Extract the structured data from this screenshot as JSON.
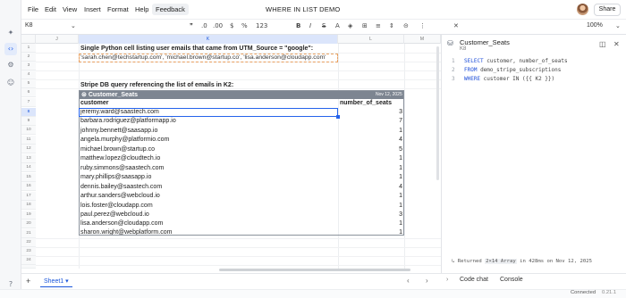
{
  "app": {
    "title": "WHERE IN LIST DEMO",
    "share_label": "Share"
  },
  "menu": [
    "File",
    "Edit",
    "View",
    "Insert",
    "Format",
    "Help",
    "Feedback"
  ],
  "toolbar": {
    "cell_ref": "K8",
    "zoom": "100%",
    "format_buttons": [
      ".0",
      ".00",
      "%",
      "123"
    ]
  },
  "columns": [
    "J",
    "K",
    "L",
    "M"
  ],
  "rows": [
    "1",
    "2",
    "3",
    "4",
    "5",
    "6",
    "7",
    "8",
    "9",
    "10",
    "11",
    "12",
    "13",
    "14",
    "15",
    "16",
    "17",
    "18",
    "19",
    "20",
    "21",
    "22",
    "23",
    "24",
    "25"
  ],
  "sheet": {
    "heading1": "Single Python cell listing user emails that came from UTM_Source = \"google\":",
    "emails_list": "'sarah.chen@techstartup.com', 'michael.brown@startup.co', 'lisa.anderson@cloudapp.com'",
    "heading2": "Stripe DB query referencing the list of emails in K2:"
  },
  "table": {
    "name": "Customer_Seats",
    "date": "Nov 12, 2025",
    "headers": [
      "customer",
      "number_of_seats"
    ],
    "rows": [
      {
        "customer": "jeremy.ward@saastech.com",
        "seats": "3"
      },
      {
        "customer": "barbara.rodriguez@platformapp.io",
        "seats": "7"
      },
      {
        "customer": "johnny.bennett@saasapp.io",
        "seats": "1"
      },
      {
        "customer": "angela.murphy@platformio.com",
        "seats": "4"
      },
      {
        "customer": "michael.brown@startup.co",
        "seats": "5"
      },
      {
        "customer": "matthew.lopez@cloudtech.io",
        "seats": "1"
      },
      {
        "customer": "ruby.simmons@saastech.com",
        "seats": "1"
      },
      {
        "customer": "mary.phillips@saasapp.io",
        "seats": "1"
      },
      {
        "customer": "dennis.bailey@saastech.com",
        "seats": "4"
      },
      {
        "customer": "arthur.sanders@webcloud.io",
        "seats": "1"
      },
      {
        "customer": "lois.foster@cloudapp.com",
        "seats": "1"
      },
      {
        "customer": "paul.perez@webcloud.io",
        "seats": "3"
      },
      {
        "customer": "lisa.anderson@cloudapp.com",
        "seats": "1"
      },
      {
        "customer": "sharon.wright@webplatform.com",
        "seats": "1"
      }
    ]
  },
  "panel": {
    "title": "Customer_Seats",
    "cell": "K8",
    "code": [
      {
        "n": "1",
        "kw": "SELECT",
        "rest": " customer, number_of_seats"
      },
      {
        "n": "2",
        "kw": "FROM",
        "rest": " demo_stripe_subscriptions"
      },
      {
        "n": "3",
        "kw": "WHERE",
        "rest": " customer IN ({{ K2 }})"
      }
    ],
    "result": {
      "pre": "Returned",
      "chip": "2×14 Array",
      "post": "in 428ms on Nov 12, 2025"
    },
    "tabs": [
      "Code chat",
      "Console"
    ]
  },
  "sheet_tab": "Sheet1",
  "status": {
    "connection": "Connected",
    "version": "0.21.1"
  }
}
